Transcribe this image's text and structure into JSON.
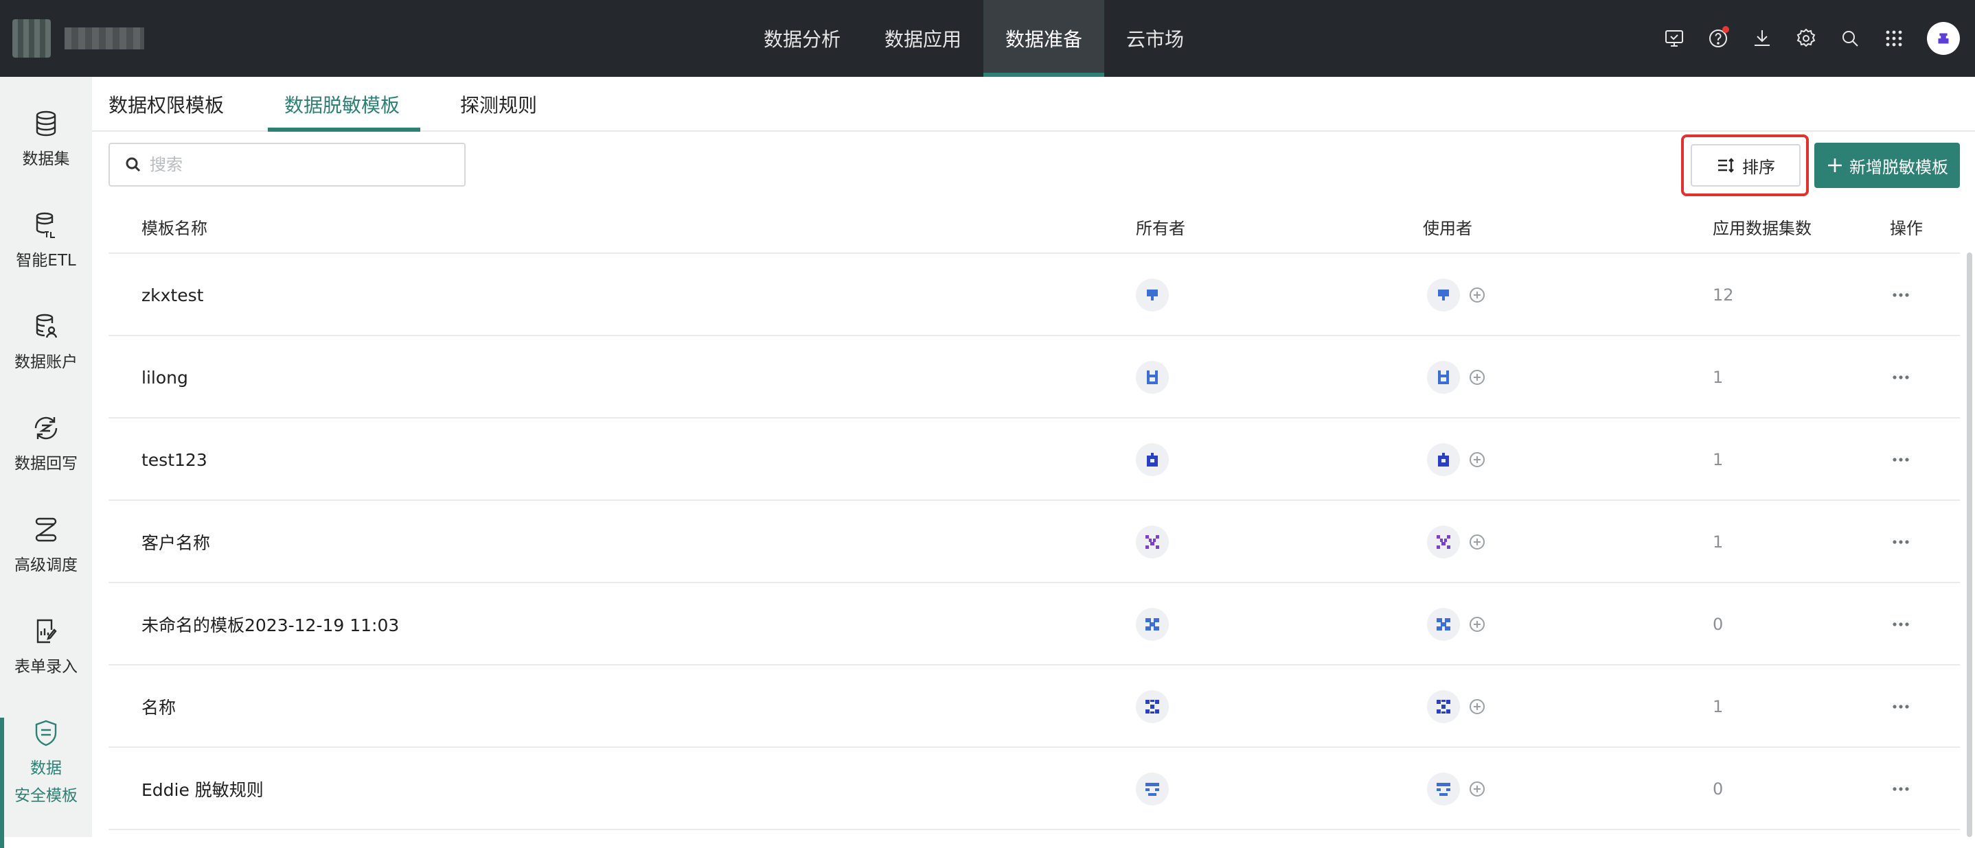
{
  "topbar": {
    "nav": [
      {
        "label": "数据分析",
        "active": false
      },
      {
        "label": "数据应用",
        "active": false
      },
      {
        "label": "数据准备",
        "active": true
      },
      {
        "label": "云市场",
        "active": false
      }
    ],
    "icons": [
      "monitor-icon",
      "help-icon",
      "download-icon",
      "gear-icon",
      "search-icon",
      "apps-grid-icon",
      "avatar"
    ],
    "accent": "#2d8074"
  },
  "sidebar": {
    "items": [
      {
        "label": "数据集",
        "icon": "database-icon"
      },
      {
        "label": "智能ETL",
        "icon": "etl-icon"
      },
      {
        "label": "数据账户",
        "icon": "data-account-icon"
      },
      {
        "label": "数据回写",
        "icon": "writeback-icon"
      },
      {
        "label": "高级调度",
        "icon": "schedule-icon"
      },
      {
        "label": "表单录入",
        "icon": "form-entry-icon"
      },
      {
        "label_line1": "数据",
        "label_line2": "安全模板",
        "icon": "security-template-icon",
        "active": true
      }
    ]
  },
  "tabs": [
    {
      "label": "数据权限模板",
      "active": false
    },
    {
      "label": "数据脱敏模板",
      "active": true
    },
    {
      "label": "探测规则",
      "active": false
    }
  ],
  "toolbar": {
    "search_placeholder": "搜索",
    "sort_label": "排序",
    "add_label": "新增脱敏模板"
  },
  "table": {
    "headers": {
      "name": "模板名称",
      "owner": "所有者",
      "users": "使用者",
      "count": "应用数据集数",
      "actions": "操作"
    },
    "rows": [
      {
        "name": "zkxtest",
        "count": "12",
        "avatar_color": "#3b6fd6",
        "pattern": 0
      },
      {
        "name": "lilong",
        "count": "1",
        "avatar_color": "#3b6fd6",
        "pattern": 1
      },
      {
        "name": "test123",
        "count": "1",
        "avatar_color": "#2a3fc4",
        "pattern": 2
      },
      {
        "name": "客户名称",
        "count": "1",
        "avatar_color": "#7a3fd6",
        "pattern": 3
      },
      {
        "name": "未命名的模板2023-12-19 11:03",
        "count": "0",
        "avatar_color": "#3b6fd6",
        "pattern": 4
      },
      {
        "name": "名称",
        "count": "1",
        "avatar_color": "#2a3fc4",
        "pattern": 5
      },
      {
        "name": "Eddie 脱敏规则",
        "count": "0",
        "avatar_color": "#3b6fd6",
        "pattern": 6
      }
    ]
  }
}
